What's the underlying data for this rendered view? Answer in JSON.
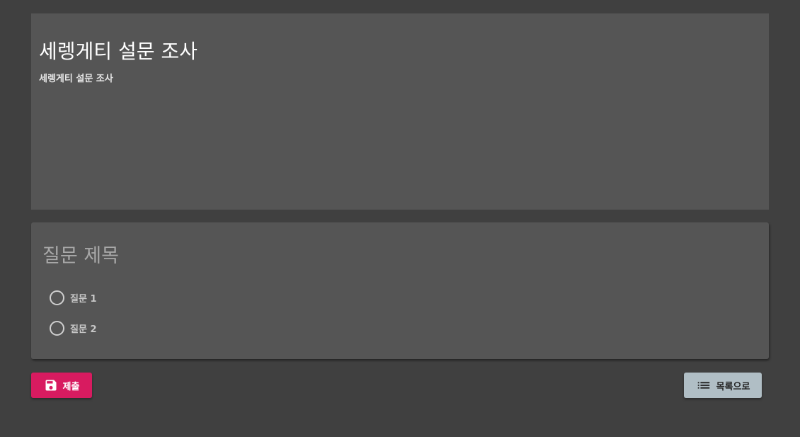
{
  "survey": {
    "title": "세렝게티 설문 조사",
    "description": "세렝게티 설문 조사"
  },
  "question": {
    "title": "질문 제목",
    "options": [
      {
        "label": "질문 1",
        "selected": false
      },
      {
        "label": "질문 2",
        "selected": false
      }
    ]
  },
  "actions": {
    "submit_label": "제출",
    "submit_icon": "save-icon",
    "back_to_list_label": "목록으로",
    "back_to_list_icon": "list-icon"
  },
  "colors": {
    "background": "#404040",
    "card": "#555555",
    "submit": "#d81b60",
    "list_button": "#b0bec5"
  }
}
